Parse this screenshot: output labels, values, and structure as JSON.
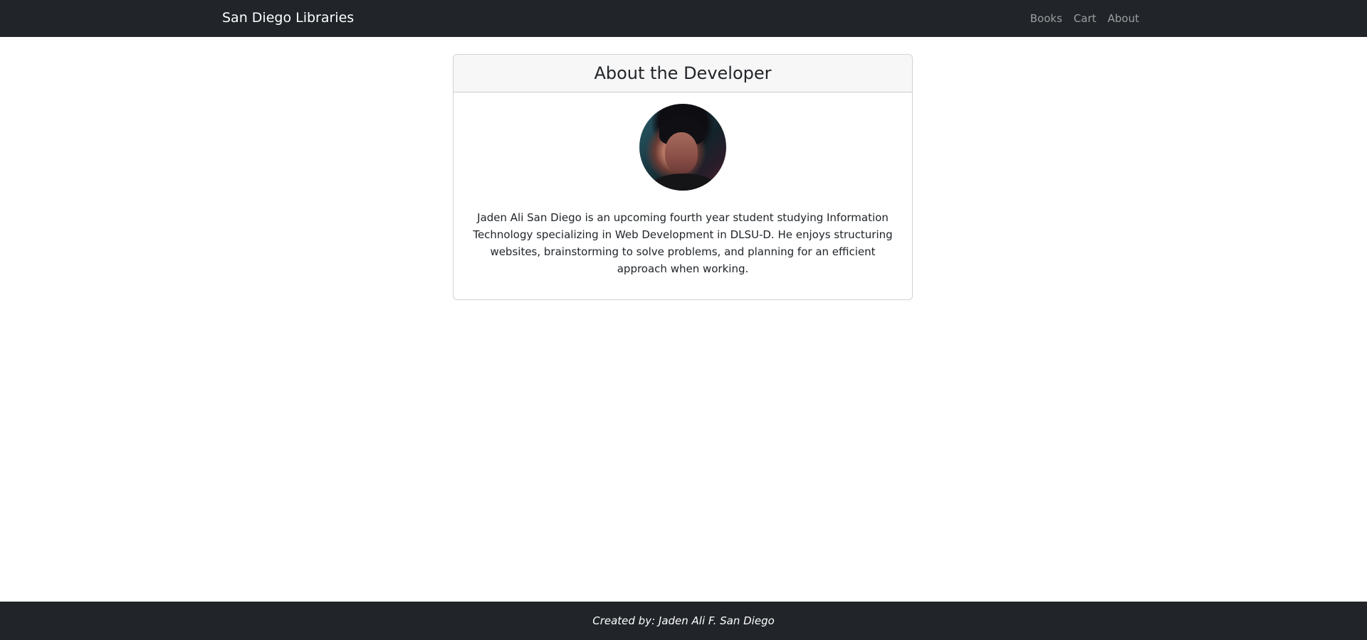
{
  "navbar": {
    "brand": "San Diego Libraries",
    "links": [
      "Books",
      "Cart",
      "About"
    ]
  },
  "card": {
    "title": "About the Developer",
    "avatar_icon": "developer-avatar",
    "bio": "Jaden Ali San Diego is an upcoming fourth year student studying Information Technology specializing in Web Development in DLSU-D. He enjoys structuring websites, brainstorming to solve problems, and planning for an efficient approach when working."
  },
  "footer": {
    "text": "Created by: Jaden Ali F. San Diego"
  },
  "colors": {
    "navbar_bg": "#212529",
    "card_header_bg": "#f7f7f7",
    "page_bg": "#ffffff"
  }
}
